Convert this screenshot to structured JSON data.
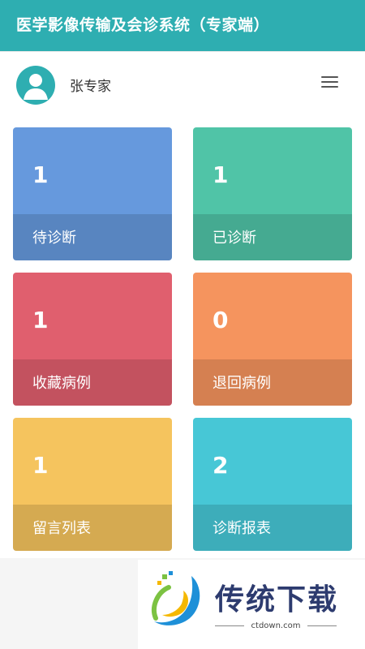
{
  "header": {
    "title": "医学影像传输及会诊系统（专家端）"
  },
  "user": {
    "name": "张专家"
  },
  "tiles": [
    {
      "count": "1",
      "label": "待诊断",
      "color": "#6699dd"
    },
    {
      "count": "1",
      "label": "已诊断",
      "color": "#50c4a7"
    },
    {
      "count": "1",
      "label": "收藏病例",
      "color": "#e05f6e"
    },
    {
      "count": "0",
      "label": "退回病例",
      "color": "#f5945e"
    },
    {
      "count": "1",
      "label": "留言列表",
      "color": "#f5c45e"
    },
    {
      "count": "2",
      "label": "诊断报表",
      "color": "#47c7d6"
    }
  ],
  "watermark": {
    "brand": "传统下载",
    "domain": "ctdown.com"
  }
}
